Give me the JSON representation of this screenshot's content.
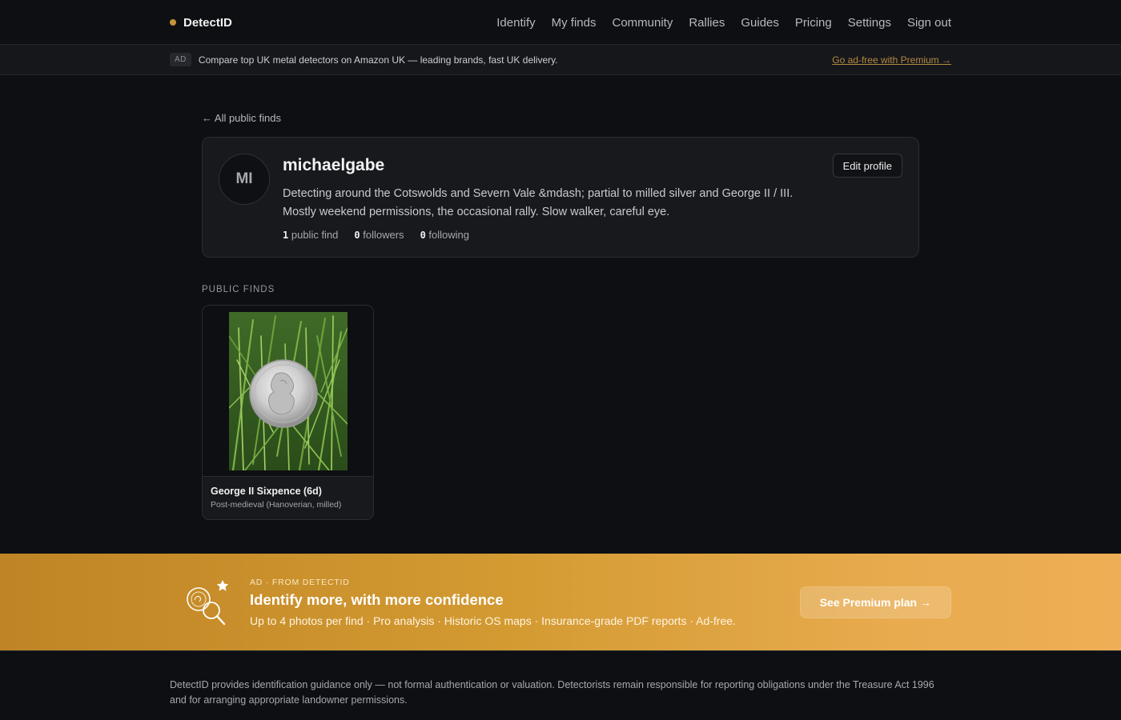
{
  "header": {
    "brand": "DetectID",
    "nav": [
      {
        "label": "Identify"
      },
      {
        "label": "My finds"
      },
      {
        "label": "Community"
      },
      {
        "label": "Rallies"
      },
      {
        "label": "Guides"
      },
      {
        "label": "Pricing"
      },
      {
        "label": "Settings"
      },
      {
        "label": "Sign out"
      }
    ]
  },
  "ad_strip": {
    "badge": "AD",
    "text": "Compare top UK metal detectors on Amazon UK — leading brands, fast UK delivery.",
    "premium_link": "Go ad-free with Premium →"
  },
  "profile": {
    "back_link": "← All public finds",
    "avatar_initials": "MI",
    "username": "michaelgabe",
    "bio": "Detecting around the Cotswolds and Severn Vale &mdash; partial to milled silver and George II / III. Mostly weekend permissions, the occasional rally. Slow walker, careful eye.",
    "edit_label": "Edit profile",
    "stats": {
      "finds_count": "1",
      "finds_label": "public find",
      "followers_count": "0",
      "followers_label": "followers",
      "following_count": "0",
      "following_label": "following"
    }
  },
  "finds": {
    "section_title": "PUBLIC FINDS",
    "items": [
      {
        "title": "George II Sixpence (6d)",
        "subtitle": "Post-medieval (Hanoverian, milled)"
      }
    ]
  },
  "premium_banner": {
    "eyebrow": "AD · FROM DETECTID",
    "title": "Identify more, with more confidence",
    "subtitle": "Up to 4 photos per find · Pro analysis · Historic OS maps · Insurance-grade PDF reports · Ad-free.",
    "button": "See Premium plan →"
  },
  "footer": {
    "disclaimer": "DetectID provides identification guidance only — not formal authentication or valuation. Detectorists remain responsible for reporting obligations under the Treasure Act 1996 and for arranging appropriate landowner permissions."
  },
  "colors": {
    "accent": "#c8923a",
    "background": "#0e0f12",
    "card": "#17191d",
    "banner_start": "#bf8425",
    "banner_end": "#eeae55"
  }
}
